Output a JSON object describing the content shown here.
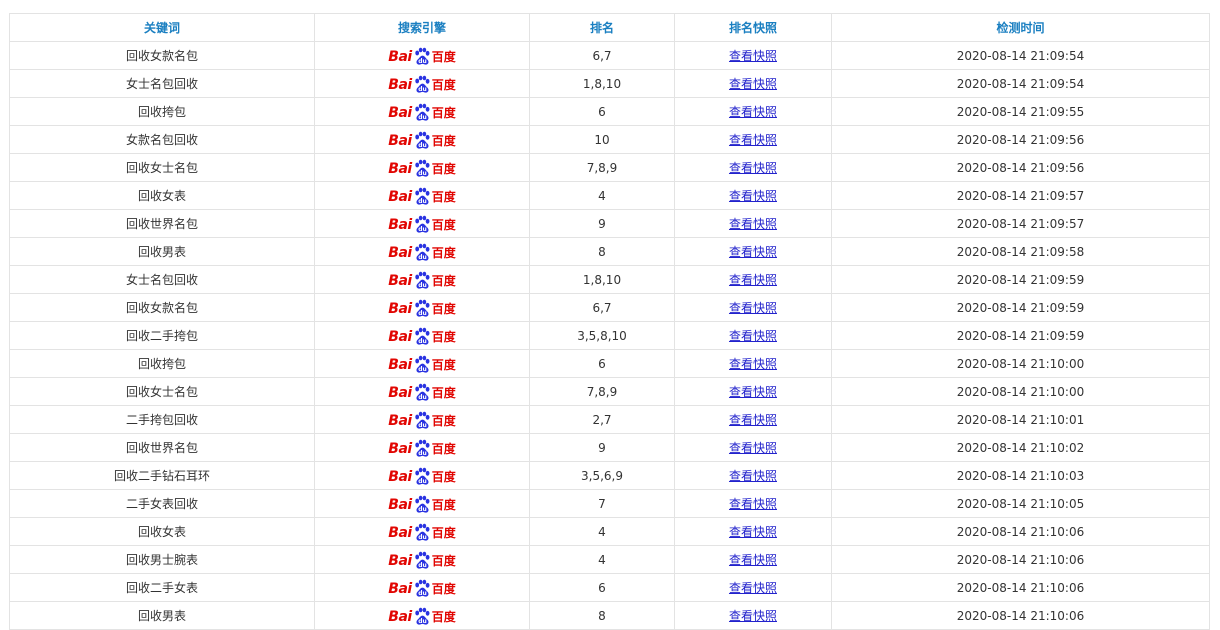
{
  "columns": [
    "关键词",
    "搜索引擎",
    "排名",
    "排名快照",
    "检测时间"
  ],
  "engine": {
    "logo_text": "Bai",
    "logo_cn": "百度",
    "icon": "baidu-paw-icon",
    "color": "#e10602"
  },
  "snapshot_label": "查看快照",
  "rows": [
    {
      "keyword": "回收女款名包",
      "rank": "6,7",
      "time": "2020-08-14 21:09:54"
    },
    {
      "keyword": "女士名包回收",
      "rank": "1,8,10",
      "time": "2020-08-14 21:09:54"
    },
    {
      "keyword": "回收挎包",
      "rank": "6",
      "time": "2020-08-14 21:09:55"
    },
    {
      "keyword": "女款名包回收",
      "rank": "10",
      "time": "2020-08-14 21:09:56"
    },
    {
      "keyword": "回收女士名包",
      "rank": "7,8,9",
      "time": "2020-08-14 21:09:56"
    },
    {
      "keyword": "回收女表",
      "rank": "4",
      "time": "2020-08-14 21:09:57"
    },
    {
      "keyword": "回收世界名包",
      "rank": "9",
      "time": "2020-08-14 21:09:57"
    },
    {
      "keyword": "回收男表",
      "rank": "8",
      "time": "2020-08-14 21:09:58"
    },
    {
      "keyword": "女士名包回收",
      "rank": "1,8,10",
      "time": "2020-08-14 21:09:59"
    },
    {
      "keyword": "回收女款名包",
      "rank": "6,7",
      "time": "2020-08-14 21:09:59"
    },
    {
      "keyword": "回收二手挎包",
      "rank": "3,5,8,10",
      "time": "2020-08-14 21:09:59"
    },
    {
      "keyword": "回收挎包",
      "rank": "6",
      "time": "2020-08-14 21:10:00"
    },
    {
      "keyword": "回收女士名包",
      "rank": "7,8,9",
      "time": "2020-08-14 21:10:00"
    },
    {
      "keyword": "二手挎包回收",
      "rank": "2,7",
      "time": "2020-08-14 21:10:01"
    },
    {
      "keyword": "回收世界名包",
      "rank": "9",
      "time": "2020-08-14 21:10:02"
    },
    {
      "keyword": "回收二手钻石耳环",
      "rank": "3,5,6,9",
      "time": "2020-08-14 21:10:03"
    },
    {
      "keyword": "二手女表回收",
      "rank": "7",
      "time": "2020-08-14 21:10:05"
    },
    {
      "keyword": "回收女表",
      "rank": "4",
      "time": "2020-08-14 21:10:06"
    },
    {
      "keyword": "回收男士腕表",
      "rank": "4",
      "time": "2020-08-14 21:10:06"
    },
    {
      "keyword": "回收二手女表",
      "rank": "6",
      "time": "2020-08-14 21:10:06"
    },
    {
      "keyword": "回收男表",
      "rank": "8",
      "time": "2020-08-14 21:10:06"
    }
  ]
}
